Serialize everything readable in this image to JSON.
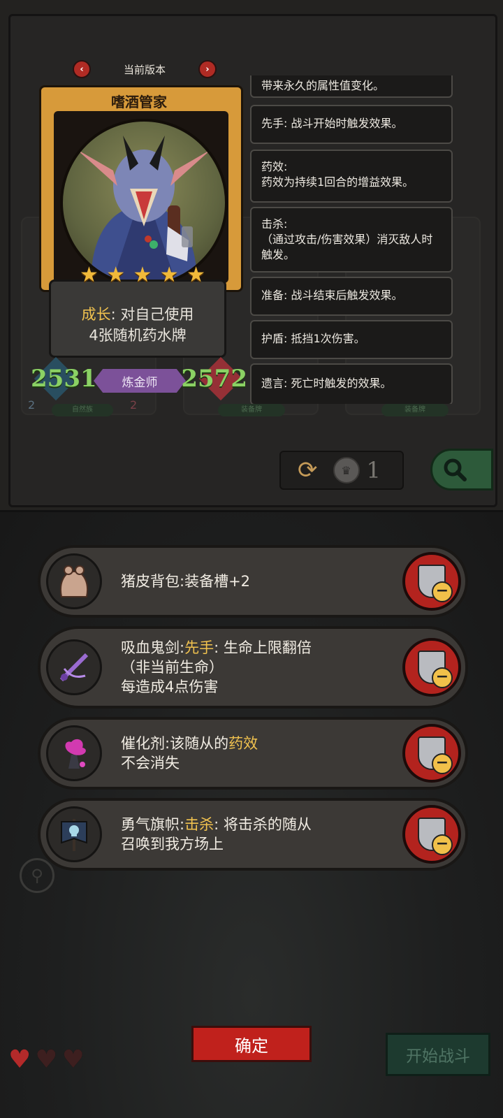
{
  "version_bar": {
    "prev": "‹",
    "label": "当前版本",
    "next": "›"
  },
  "hero": {
    "name": "嗜酒管家",
    "stars": [
      "★",
      "★",
      "★",
      "★",
      "★"
    ],
    "ability_keyword": "成长",
    "ability_sep": ":",
    "ability_rest": "对自己使用",
    "ability_line2": "4张随机药水牌",
    "attack": "2531",
    "health": "2572",
    "class_label": "炼金师"
  },
  "keywords": [
    {
      "text": "带来永久的属性值变化。"
    },
    {
      "text": "先手: 战斗开始时触发效果。"
    },
    {
      "line1": "药效:",
      "line2": "药效为持续1回合的增益效果。"
    },
    {
      "line1": "击杀:",
      "line2": "（通过攻击/伤害效果）消灭敌人时触发。"
    },
    {
      "text": "准备: 战斗结束后触发效果。"
    },
    {
      "text": "护盾: 抵挡1次伤害。"
    },
    {
      "text": "遗言: 死亡时触发的效果。"
    }
  ],
  "background_cards": {
    "left_count_1": "2",
    "left_tag": "自然族",
    "left_count_2": "2",
    "mid_tag": "装备牌",
    "right_tag": "装备牌"
  },
  "refresh": {
    "icon": "refresh-icon",
    "count": "1"
  },
  "equipment": [
    {
      "name": "猪皮背包",
      "sep": ":",
      "rest": "装备槽+2",
      "line2": "",
      "line3": ""
    },
    {
      "name": "吸血鬼剑",
      "sep": ":",
      "keyword": "先手",
      "rest": ": 生命上限翻倍",
      "line2": "（非当前生命）",
      "line3": "每造成4点伤害"
    },
    {
      "name": "催化剂",
      "sep": ":",
      "pre": "该随从的",
      "keyword": "药效",
      "line2": "不会消失"
    },
    {
      "name": "勇气旗帜",
      "sep": ":",
      "keyword": "击杀",
      "rest": ": 将击杀的随从",
      "line2": "召唤到我方场上"
    }
  ],
  "confirm_label": "确定",
  "start_battle_label": "开始战斗",
  "lives": {
    "hearts": [
      "♥",
      "♥",
      "♥"
    ]
  },
  "colors": {
    "accent_red": "#c0211c",
    "keyword_gold": "#f1c24f",
    "stat_green": "#8bd164",
    "class_purple": "#7c5199"
  }
}
